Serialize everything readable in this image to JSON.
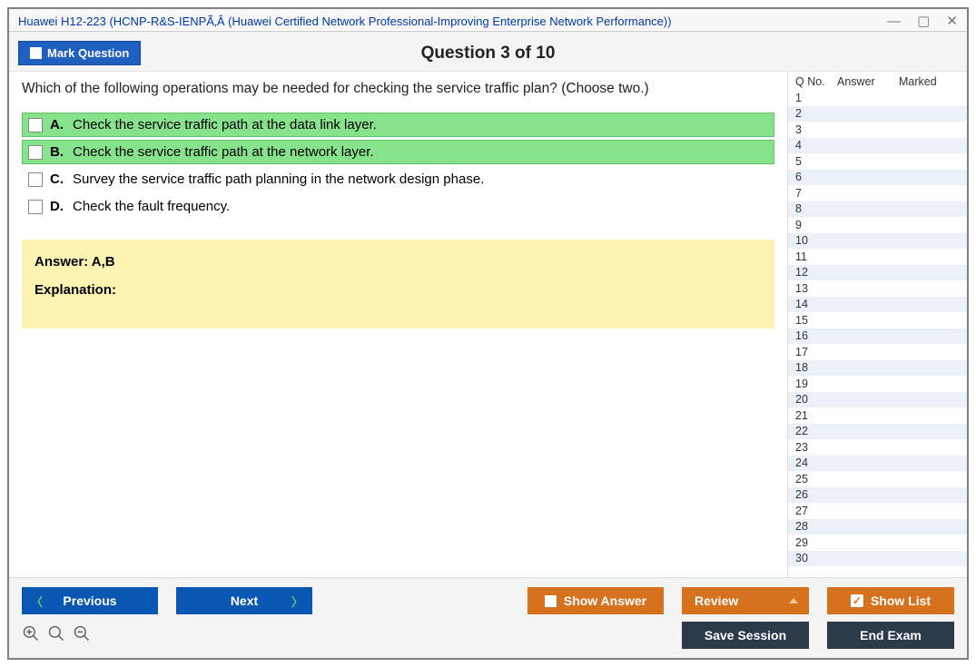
{
  "window": {
    "title": "Huawei H12-223 (HCNP-R&S-IENPÃ‚Â (Huawei Certified Network Professional-Improving Enterprise Network Performance))"
  },
  "header": {
    "mark_label": "Mark Question",
    "question_counter": "Question 3 of 10"
  },
  "question": {
    "text": "Which of the following operations may be needed for checking the service traffic plan? (Choose two.)",
    "choices": [
      {
        "letter": "A.",
        "text": "Check the service traffic path at the data link layer.",
        "correct": true
      },
      {
        "letter": "B.",
        "text": "Check the service traffic path at the network layer.",
        "correct": true
      },
      {
        "letter": "C.",
        "text": "Survey the service traffic path planning in the network design phase.",
        "correct": false
      },
      {
        "letter": "D.",
        "text": "Check the fault frequency.",
        "correct": false
      }
    ],
    "answer_label": "Answer: A,B",
    "explanation_label": "Explanation:"
  },
  "sidebar": {
    "headers": {
      "qno": "Q No.",
      "answer": "Answer",
      "marked": "Marked"
    },
    "rows_from": 1,
    "rows_to": 30
  },
  "footer": {
    "previous": "Previous",
    "next": "Next",
    "show_answer": "Show Answer",
    "review": "Review",
    "show_list": "Show List",
    "save_session": "Save Session",
    "end_exam": "End Exam"
  }
}
